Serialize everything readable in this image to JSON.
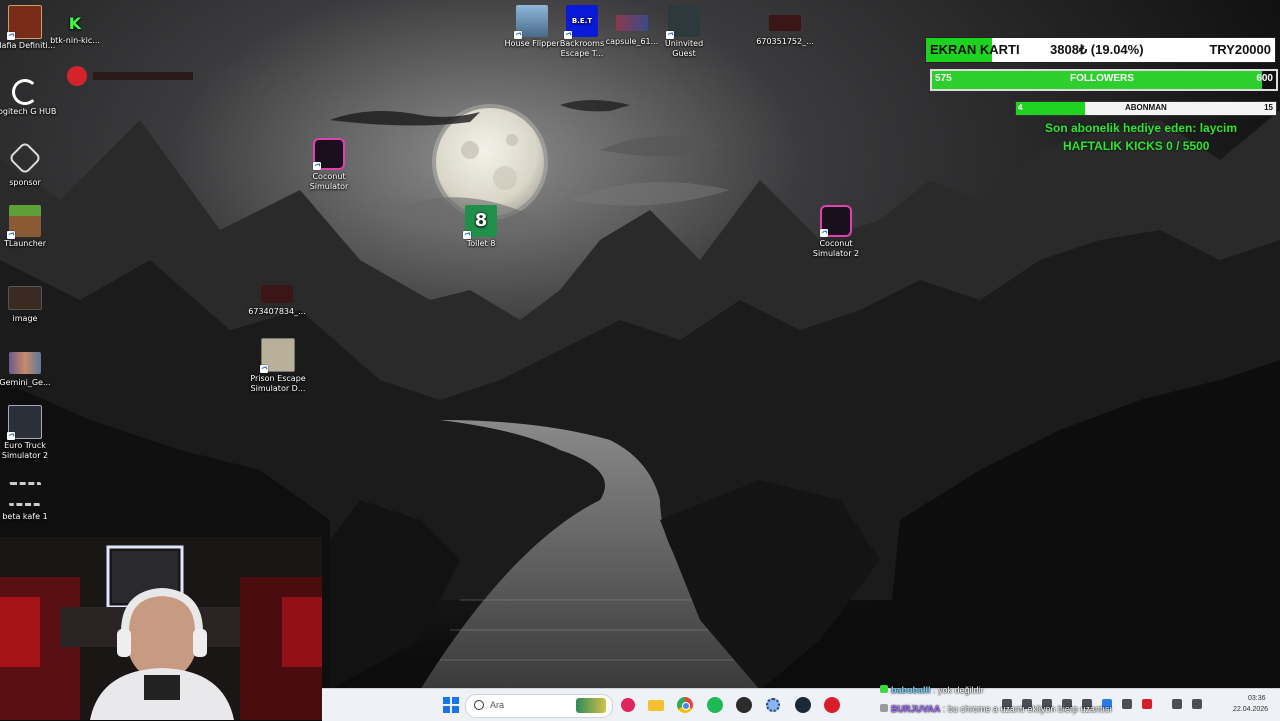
{
  "desktop": {
    "icons": [
      {
        "label": "Mafia Definiti...",
        "icon": "mafia-game-icon"
      },
      {
        "label": "btk-nin-kic...",
        "icon": "kick-icon"
      },
      {
        "label": "Logitech G HUB",
        "icon": "logitech-g-hub-icon"
      },
      {
        "label": "sponsor",
        "icon": "sponsor-icon"
      },
      {
        "label": "TLauncher",
        "icon": "tlauncher-icon"
      },
      {
        "label": "image",
        "icon": "image-icon"
      },
      {
        "label": "Gemini_Ge...",
        "icon": "gemini-image-icon"
      },
      {
        "label": "Euro Truck Simulator 2",
        "icon": "euro-truck-icon"
      },
      {
        "label": "beta kafe 1",
        "icon": "film-icon"
      },
      {
        "label": "Coconut Simulator",
        "icon": "coconut-simulator-icon"
      },
      {
        "label": "673407834_...",
        "icon": "image-thumb-icon"
      },
      {
        "label": "Prison Escape Simulator D...",
        "icon": "prison-escape-icon"
      },
      {
        "label": "Toilet 8",
        "icon": "toilet-8-icon"
      },
      {
        "label": "House Flipper",
        "icon": "house-flipper-icon"
      },
      {
        "label": "Backrooms Escape T...",
        "icon": "backrooms-icon"
      },
      {
        "label": "capsule_61...",
        "icon": "capsule-image-icon"
      },
      {
        "label": "Uninvited Guest",
        "icon": "uninvited-guest-icon"
      },
      {
        "label": "670351752_...",
        "icon": "image-thumb-icon"
      },
      {
        "label": "Coconut Simulator 2",
        "icon": "coconut-simulator-icon"
      }
    ]
  },
  "overlay": {
    "gpu_goal": {
      "label": "EKRAN KARTI",
      "amount": "3808₺ (19.04%)",
      "target": "TRY20000",
      "progress": 0.1904,
      "color": "#1fd21f"
    },
    "followers": {
      "current": "575",
      "label": "FOLLOWERS",
      "goal": "600",
      "progress": 0.958
    },
    "subs": {
      "current": "4",
      "label": "ABONMAN",
      "goal": "15",
      "progress": 0.267
    },
    "last_gift": "Son abonelik hediye eden: laycim",
    "weekly_kicks": "HAFTALIK KICKS 0 / 5500"
  },
  "taskbar": {
    "search_placeholder": "Ara",
    "pinned": [
      "start-icon",
      "search-icon",
      "taskview-icon",
      "media-icon",
      "folder-icon",
      "chrome-icon",
      "spotify-icon",
      "obs-icon",
      "settings-icon",
      "steam-icon",
      "app-icon"
    ],
    "clock_time": "03:36",
    "clock_date": "22.04.2026"
  },
  "chat": [
    {
      "user": "babuballl",
      "message": ": yok değildir"
    },
    {
      "user": "BURJUVAA",
      "message": ": bu chrome a uzantı ekliyon bierp uzantısı"
    }
  ]
}
